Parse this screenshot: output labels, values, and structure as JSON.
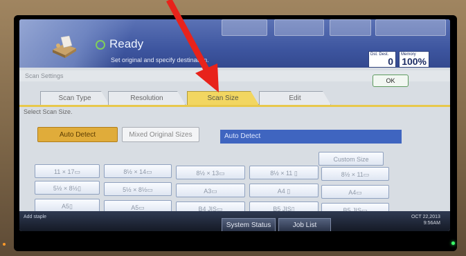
{
  "status": {
    "title": "Ready",
    "message": "Set original and specify destination.",
    "dest_label": "Dst. Dest.",
    "dest_count": "0",
    "memory_label": "Memory",
    "memory_value": "100%"
  },
  "settings": {
    "title": "Scan Settings",
    "ok_label": "OK",
    "instruction": "Select Scan Size."
  },
  "tabs": [
    {
      "label": "Scan Type"
    },
    {
      "label": "Resolution"
    },
    {
      "label": "Scan Size"
    },
    {
      "label": "Edit"
    }
  ],
  "modes": {
    "auto_detect": "Auto Detect",
    "mixed_sizes": "Mixed Original Sizes",
    "current_value": "Auto Detect"
  },
  "custom_size_label": "Custom Size",
  "sizes": [
    {
      "label": "11 × 17▭"
    },
    {
      "label": "8½ × 14▭"
    },
    {
      "label": "8½ × 13▭"
    },
    {
      "label": "8½ × 11 ▯"
    },
    {
      "label": "8½ × 11▭"
    },
    {
      "label": "5½ × 8½▯"
    },
    {
      "label": "5½ × 8½▭"
    },
    {
      "label": "A3▭"
    },
    {
      "label": "A4 ▯"
    },
    {
      "label": "A4▭"
    },
    {
      "label": "A5▯"
    },
    {
      "label": "A5▭"
    },
    {
      "label": "B4 JIS▭"
    },
    {
      "label": "B5 JIS▯"
    },
    {
      "label": "B5 JIS▭"
    }
  ],
  "bottom": {
    "address_label": "Add staple",
    "system_status": "System Status",
    "job_list": "Job List",
    "date": "OCT  22,2013",
    "time": "9:56AM"
  },
  "colors": {
    "arrow": "#e8231b",
    "active_tab": "#f2d661",
    "auto_detect": "#e0ac3a",
    "current_bar": "#3f65c0"
  }
}
